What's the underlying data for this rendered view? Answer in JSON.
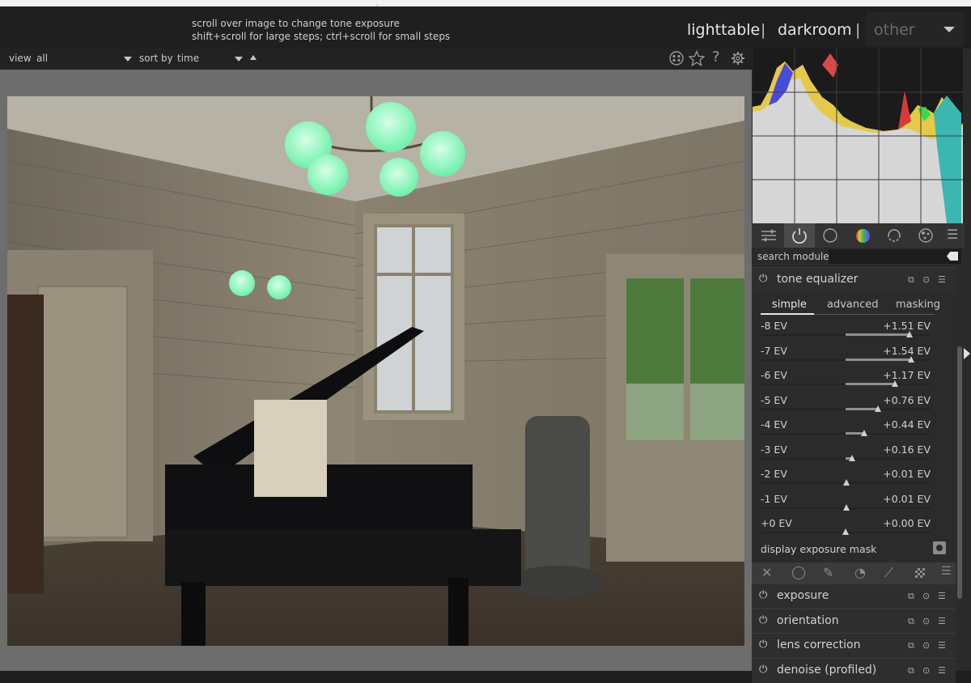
{
  "header": {
    "hint_line1": "scroll over image to change tone exposure",
    "hint_line2": "shift+scroll for large steps; ctrl+scroll for small steps",
    "view_lighttable": "lighttable",
    "view_darkroom": "darkroom",
    "separator": "|",
    "view_other": "other"
  },
  "filterbar": {
    "view_label": "view",
    "view_value": "all",
    "sort_label": "sort by",
    "sort_value": "time"
  },
  "icons": {
    "header_right": [
      "color-palette-icon",
      "star-icon",
      "help-icon",
      "settings-gear-icon"
    ],
    "module_groups": [
      "sliders-icon",
      "power-icon",
      "circle-icon",
      "color-wheel-icon",
      "correct-icon",
      "effect-icon"
    ],
    "mask_tools": [
      "close-x-icon",
      "circle-shape-icon",
      "pencil-icon",
      "gradient-icon",
      "parametric-icon",
      "raster-icon",
      "menu-icon"
    ]
  },
  "right_panel": {
    "search_label": "search module",
    "search_placeholder": "",
    "tone_equalizer": {
      "title": "tone equalizer",
      "tabs": [
        "simple",
        "advanced",
        "masking"
      ],
      "active_tab": "simple",
      "sliders": [
        {
          "label": "-8 EV",
          "value": "+1.51 EV",
          "v": 1.51
        },
        {
          "label": "-7 EV",
          "value": "+1.54 EV",
          "v": 1.54
        },
        {
          "label": "-6 EV",
          "value": "+1.17 EV",
          "v": 1.17
        },
        {
          "label": "-5 EV",
          "value": "+0.76 EV",
          "v": 0.76
        },
        {
          "label": "-4 EV",
          "value": "+0.44 EV",
          "v": 0.44
        },
        {
          "label": "-3 EV",
          "value": "+0.16 EV",
          "v": 0.16
        },
        {
          "label": "-2 EV",
          "value": "+0.01 EV",
          "v": 0.01
        },
        {
          "label": "-1 EV",
          "value": "+0.01 EV",
          "v": 0.01
        },
        {
          "label": "+0 EV",
          "value": "+0.00 EV",
          "v": 0.0
        }
      ],
      "display_mask_label": "display exposure mask"
    },
    "modules": [
      "exposure",
      "orientation",
      "lens correction",
      "denoise (profiled)"
    ]
  },
  "colors": {
    "accent": "#e6e6e6",
    "panel_bg": "#2a2a2a",
    "center_bg": "#6d6d6d"
  }
}
